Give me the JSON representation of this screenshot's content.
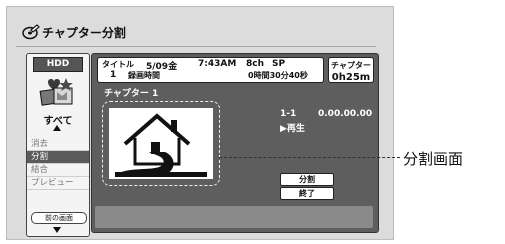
{
  "header": {
    "title": "チャプター分割",
    "icon": "disc-pencil-icon"
  },
  "sidebar": {
    "media": "HDD",
    "category_icon": "category-all-icon",
    "category": "すべて",
    "menu": [
      {
        "label": "消去",
        "selected": false
      },
      {
        "label": "分割",
        "selected": true
      },
      {
        "label": "結合",
        "selected": false
      },
      {
        "label": "プレビュー",
        "selected": false
      }
    ],
    "back_button": "前の画面"
  },
  "info": {
    "title_label": "タイトル",
    "title_number": "1",
    "date": "5/09金",
    "time": "7:43AM",
    "channel": "8ch",
    "mode": "SP",
    "rec_time_label": "録画時間",
    "rec_time": "0時間30分40秒",
    "chapter_label": "チャプター",
    "chapter_length": "0h25m"
  },
  "main": {
    "chapter_title": "チャプター 1",
    "chapter_index": "1-1",
    "timecode": "0.00.00.00",
    "status": "▶再生",
    "thumbnail_icon": "house-icon",
    "split_button": "分割",
    "end_button": "終了"
  },
  "callout": "分割画面",
  "colors": {
    "panel": "#5e5e5e",
    "frame": "#dcdcdc",
    "selected": "#5a5a5a"
  }
}
